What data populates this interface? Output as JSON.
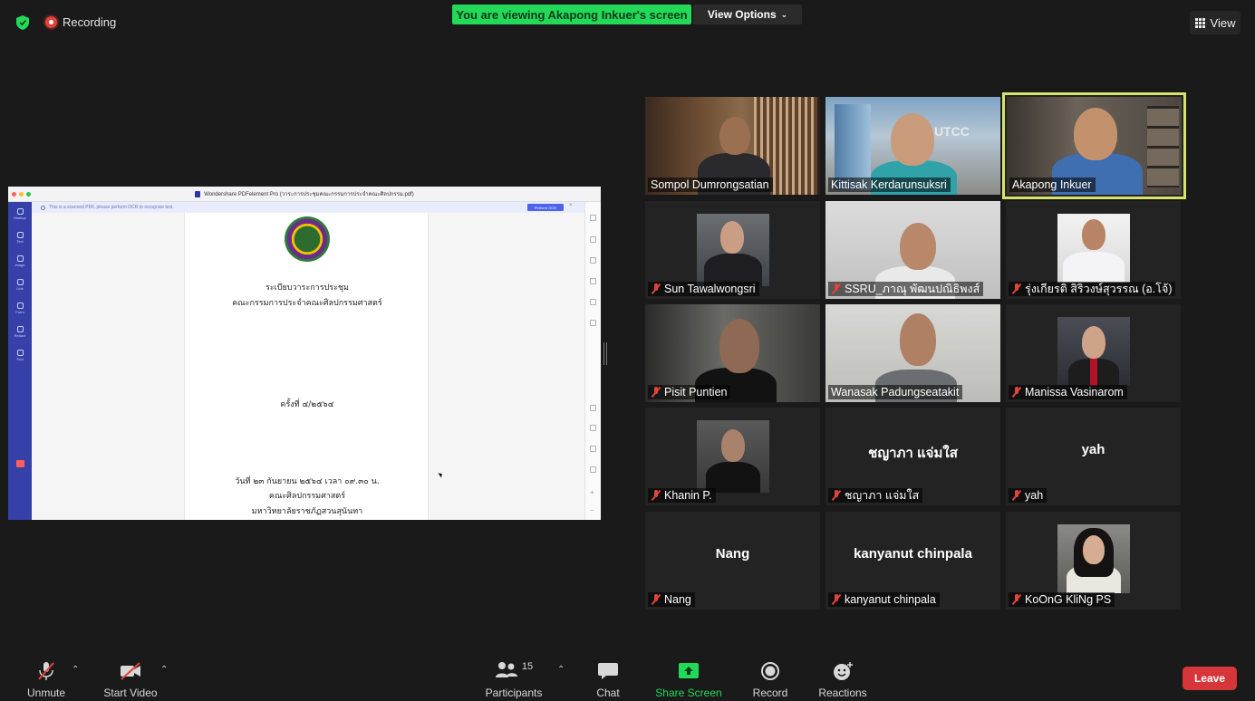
{
  "topbar": {
    "recording_label": "Recording",
    "viewing_banner": "You are viewing Akapong Inkuer's screen",
    "view_options_label": "View Options",
    "view_label": "View",
    "colors": {
      "banner": "#23d959",
      "recording": "#e0443a",
      "shield": "#23d959"
    }
  },
  "shared_screen": {
    "window_title": "Wondershare PDFelement Pro (วาระการประชุมคณะกรรมการประจำคณะศิลปกรรม.pdf)",
    "ocr_notice": "This is a scanned PDF, please perform OCR to recognize text.",
    "ocr_button": "Perform OCR",
    "sidebar_items": [
      "Markup",
      "Text",
      "Image",
      "Link",
      "Form",
      "Redact",
      "Tool"
    ],
    "page_lines": [
      "ระเบียบวาระการประชุม",
      "คณะกรรมการประจำคณะศิลปกรรมศาสตร์",
      "ครั้งที่ ๔/๒๕๖๔",
      "วันที่ ๒๓ กันยายน ๒๕๖๔ เวลา ๐๙.๓๐ น.",
      "คณะศิลปกรรมศาสตร์",
      "มหาวิทยาลัยราชภัฏสวนสุนันทา"
    ]
  },
  "participants": [
    {
      "name": "Sompol Dumrongsatian",
      "muted": false,
      "video": true
    },
    {
      "name": "Kittisak Kerdarunsuksri",
      "muted": false,
      "video": true
    },
    {
      "name": "Akapong Inkuer",
      "muted": false,
      "video": true,
      "active_speaker": true
    },
    {
      "name": "Sun Tawalwongsri",
      "muted": true,
      "video": true
    },
    {
      "name": "SSRU_ภาณุ พัฒนปณิธิพงส์",
      "muted": true,
      "video": true
    },
    {
      "name": "รุ่งเกียรติ สิริวงษ์สุวรรณ (อ.โจ้)",
      "muted": true,
      "video": true
    },
    {
      "name": "Pisit Puntien",
      "muted": true,
      "video": true
    },
    {
      "name": "Wanasak Padungseataki­t",
      "muted": false,
      "video": true
    },
    {
      "name": "Manissa  Vasinarom",
      "muted": true,
      "video": true
    },
    {
      "name": "Khanin P.",
      "muted": true,
      "video": true
    },
    {
      "name": "ชญาภา  แจ่มใส",
      "muted": true,
      "video": false,
      "display_name": "ชญาภา  แจ่มใส"
    },
    {
      "name": "yah",
      "muted": true,
      "video": false,
      "display_name": "yah"
    },
    {
      "name": "Nang",
      "muted": true,
      "video": false,
      "display_name": "Nang"
    },
    {
      "name": "kanyanut chinpala",
      "muted": true,
      "video": false,
      "display_name": "kanyanut chinpala"
    },
    {
      "name": "KoOnG KliNg PS",
      "muted": true,
      "video": true
    }
  ],
  "toolbar": {
    "unmute": "Unmute",
    "start_video": "Start Video",
    "participants": "Participants",
    "participant_count": "15",
    "chat": "Chat",
    "share_screen": "Share Screen",
    "record": "Record",
    "reactions": "Reactions",
    "leave": "Leave",
    "colors": {
      "share": "#23d959",
      "leave": "#d6353a",
      "muted": "#e0443a"
    }
  }
}
